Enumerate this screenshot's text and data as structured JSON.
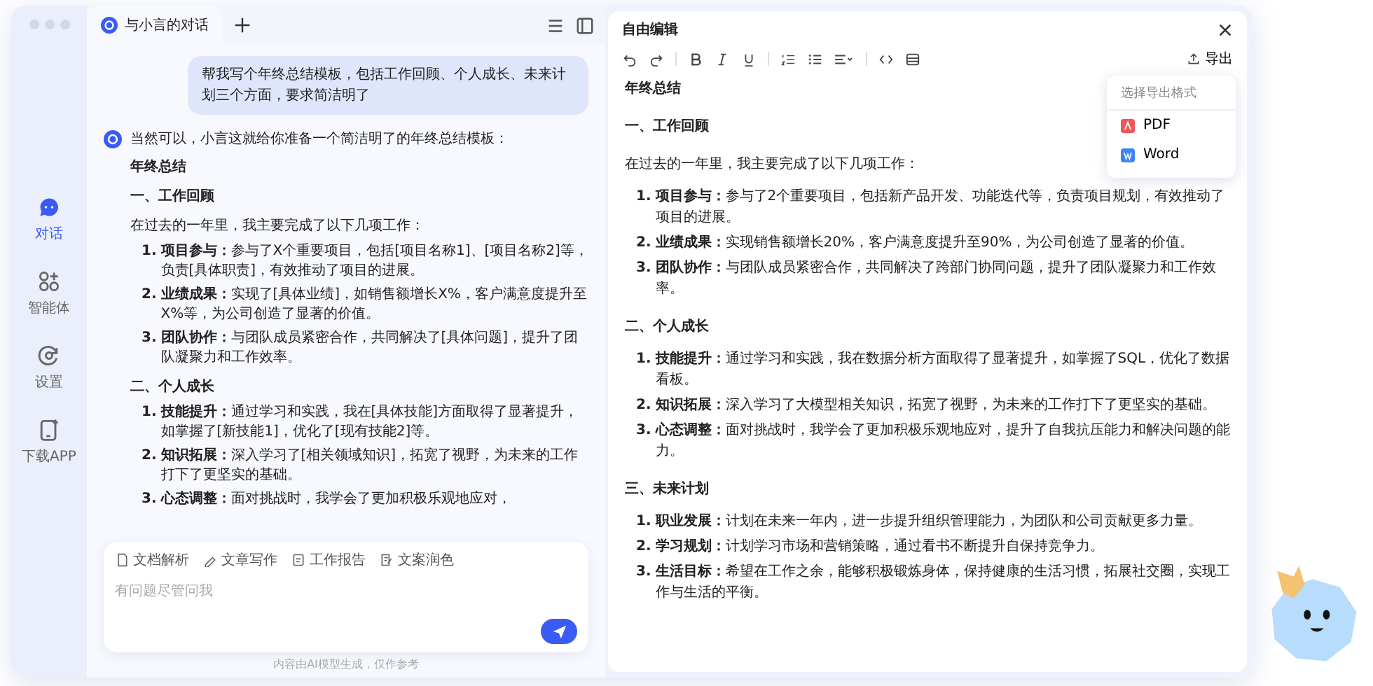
{
  "sidebar": {
    "items": [
      {
        "label": "对话",
        "selected": true
      },
      {
        "label": "智能体",
        "selected": false
      },
      {
        "label": "设置",
        "selected": false
      },
      {
        "label": "下载APP",
        "selected": false
      }
    ]
  },
  "chat": {
    "tab": {
      "title": "与小言的对话"
    },
    "user_message": "帮我写个年终总结模板，包括工作回顾、个人成长、未来计划三个方面，要求简洁明了",
    "reply_intro": "当然可以，小言这就给你准备一个简洁明了的年终总结模板：",
    "blocks": [
      {
        "kind": "title",
        "text": "年终总结"
      },
      {
        "kind": "heading",
        "text": "一、工作回顾"
      },
      {
        "kind": "paragraph",
        "text": "在过去的一年里，我主要完成了以下几项工作："
      },
      {
        "kind": "list",
        "items": [
          {
            "number": "1.",
            "text": "**项目参与：**参与了X个重要项目，包括[项目名称1]、[项目名称2]等，负责[具体职责]，有效推动了项目的进展。"
          },
          {
            "number": "2.",
            "text": "**业绩成果：**实现了[具体业绩]，如销售额增长X%，客户满意度提升至X%等，为公司创造了显著的价值。"
          },
          {
            "number": "3.",
            "text": "**团队协作：**与团队成员紧密合作，共同解决了[具体问题]，提升了团队凝聚力和工作效率。"
          }
        ]
      },
      {
        "kind": "heading",
        "text": "二、个人成长"
      },
      {
        "kind": "list",
        "items": [
          {
            "number": "1.",
            "text": "**技能提升：**通过学习和实践，我在[具体技能]方面取得了显著提升，如掌握了[新技能1]，优化了[现有技能2]等。"
          },
          {
            "number": "2.",
            "text": "**知识拓展：**深入学习了[相关领域知识]，拓宽了视野，为未来的工作打下了更坚实的基础。"
          },
          {
            "number": "3.",
            "text": "**心态调整：**面对挑战时，我学会了更加积极乐观地应对，"
          }
        ]
      }
    ],
    "input": {
      "chips": [
        {
          "label": "文档解析"
        },
        {
          "label": "文章写作"
        },
        {
          "label": "工作报告"
        },
        {
          "label": "文案润色"
        }
      ],
      "placeholder": "有问题尽管问我"
    },
    "footer": "内容由AI模型生成，仅作参考"
  },
  "editor": {
    "title": "自由编辑",
    "export_label": "导出",
    "export_menu": {
      "title": "选择导出格式",
      "options": [
        {
          "label": "PDF",
          "kind": "pdf"
        },
        {
          "label": "Word",
          "kind": "word"
        }
      ]
    },
    "blocks": [
      {
        "kind": "title",
        "text": "年终总结"
      },
      {
        "kind": "heading",
        "text": "一、工作回顾"
      },
      {
        "kind": "paragraph",
        "text": "在过去的一年里，我主要完成了以下几项工作："
      },
      {
        "kind": "list",
        "items": [
          {
            "number": "1.",
            "text": "**项目参与：**参与了2个重要项目，包括新产品开发、功能迭代等，负责项目规划，有效推动了项目的进展。"
          },
          {
            "number": "2.",
            "text": "**业绩成果：**实现销售额增长20%，客户满意度提升至90%，为公司创造了显著的价值。"
          },
          {
            "number": "3.",
            "text": "**团队协作：**与团队成员紧密合作，共同解决了跨部门协同问题，提升了团队凝聚力和工作效率。"
          }
        ]
      },
      {
        "kind": "heading",
        "text": "二、个人成长"
      },
      {
        "kind": "list",
        "items": [
          {
            "number": "1.",
            "text": "**技能提升：**通过学习和实践，我在数据分析方面取得了显著提升，如掌握了SQL，优化了数据看板。"
          },
          {
            "number": "2.",
            "text": "**知识拓展：**深入学习了大模型相关知识，拓宽了视野，为未来的工作打下了更坚实的基础。"
          },
          {
            "number": "3.",
            "text": "**心态调整：**面对挑战时，我学会了更加积极乐观地应对，提升了自我抗压能力和解决问题的能力。"
          }
        ]
      },
      {
        "kind": "heading",
        "text": "三、未来计划"
      },
      {
        "kind": "list",
        "items": [
          {
            "number": "1.",
            "text": "**职业发展：**计划在未来一年内，进一步提升组织管理能力，为团队和公司贡献更多力量。"
          },
          {
            "number": "2.",
            "text": "**学习规划：**计划学习市场和营销策略，通过看书不断提升自保持竞争力。"
          },
          {
            "number": "3.",
            "text": "**生活目标：**希望在工作之余，能够积极锻炼身体，保持健康的生活习惯，拓展社交圈，实现工作与生活的平衡。"
          }
        ]
      }
    ]
  }
}
